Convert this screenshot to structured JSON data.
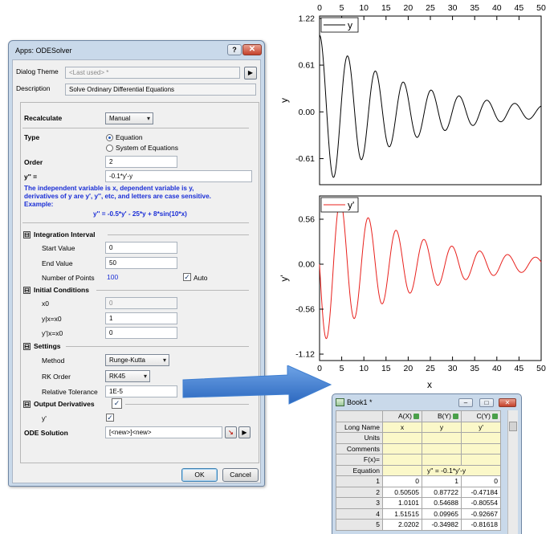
{
  "dialog": {
    "title": "Apps: ODESolver",
    "help_label": "?",
    "close_label": "✕",
    "theme_label": "Dialog Theme",
    "theme_value": "<Last used> *",
    "theme_arrow": "▶",
    "description_label": "Description",
    "description_value": "Solve Ordinary Differential Equations",
    "recalculate_label": "Recalculate",
    "recalculate_value": "Manual",
    "type_label": "Type",
    "type_options": [
      "Equation",
      "System of Equations"
    ],
    "order_label": "Order",
    "order_value": "2",
    "equation_label": "y'' =",
    "equation_value": "-0.1*y'-y",
    "hint_lines": [
      "The independent variable is x, dependent variable is y,",
      "derivatives of y are y', y'', etc, and letters are case sensitive.",
      "Example:"
    ],
    "example": "y'' = -0.5*y' - 25*y + 8*sin(10*x)",
    "section_integration": "Integration Interval",
    "start_label": "Start Value",
    "start_value": "0",
    "end_label": "End Value",
    "end_value": "50",
    "points_label": "Number of Points",
    "points_value": "100",
    "auto_label": "Auto",
    "section_initial": "Initial Conditions",
    "x0_label": "x0",
    "x0_value": "0",
    "y0_label": "y|x=x0",
    "y0_value": "1",
    "dy0_label": "y'|x=x0",
    "dy0_value": "0",
    "section_settings": "Settings",
    "method_label": "Method",
    "method_value": "Runge-Kutta",
    "rk_label": "RK Order",
    "rk_value": "RK45",
    "tol_label": "Relative Tolerance",
    "tol_value": "1E-5",
    "section_output": "Output Derivatives",
    "yprime_label": "y'",
    "ode_solution_label": "ODE Solution",
    "ode_solution_value": "[<new>]<new>",
    "ok_label": "OK",
    "cancel_label": "Cancel",
    "collapse_symbol": "⊟",
    "check_mark": "✓",
    "arrow_symbol": "▶"
  },
  "workbook": {
    "title": "Book1 *",
    "columns": [
      "A(X)",
      "B(Y)",
      "C(Y)"
    ],
    "long_name_label": "Long Name",
    "long_names": [
      "x",
      "y",
      "y'"
    ],
    "units_label": "Units",
    "comments_label": "Comments",
    "fx_label": "F(x)=",
    "equation_label": "Equation",
    "equation_value": "y'' = -0.1*y'-y",
    "rows": [
      [
        "1",
        "0",
        "1",
        "0"
      ],
      [
        "2",
        "0.50505",
        "0.87722",
        "-0.47184"
      ],
      [
        "3",
        "1.0101",
        "0.54688",
        "-0.80554"
      ],
      [
        "4",
        "1.51515",
        "0.09965",
        "-0.92667"
      ],
      [
        "5",
        "2.0202",
        "-0.34982",
        "-0.81618"
      ]
    ]
  },
  "chart_data": [
    {
      "type": "line",
      "ylabel": "y",
      "legend": "y",
      "legend_position": "top-left",
      "xlim": [
        0,
        50
      ],
      "ylim": [
        -0.95,
        1.25
      ],
      "yticks": [
        "1.22",
        "0.61",
        "0.00",
        "-0.61"
      ],
      "ytick_values": [
        1.22,
        0.61,
        0,
        -0.61
      ],
      "xticks": [
        "0",
        "5",
        "10",
        "15",
        "20",
        "25",
        "30",
        "35",
        "40",
        "45",
        "50"
      ],
      "xtick_position": "top",
      "color": "#000000",
      "equation": "y'' = -0.1*y' - y, y(0)=1, y'(0)=0",
      "points": 100
    },
    {
      "type": "line",
      "ylabel": "y'",
      "xlabel": "x",
      "legend": "y'",
      "legend_position": "top-left",
      "xlim": [
        0,
        50
      ],
      "ylim": [
        -1.2,
        0.85
      ],
      "yticks": [
        "0.56",
        "0.00",
        "-0.56",
        "-1.12"
      ],
      "ytick_values": [
        0.56,
        0,
        -0.56,
        -1.12
      ],
      "xticks": [
        "0",
        "5",
        "10",
        "15",
        "20",
        "25",
        "30",
        "35",
        "40",
        "45",
        "50"
      ],
      "xtick_position": "bottom",
      "color": "#e8201c",
      "equation": "derivative of y",
      "points": 100
    }
  ],
  "arrow_color": "#3f7fd1"
}
